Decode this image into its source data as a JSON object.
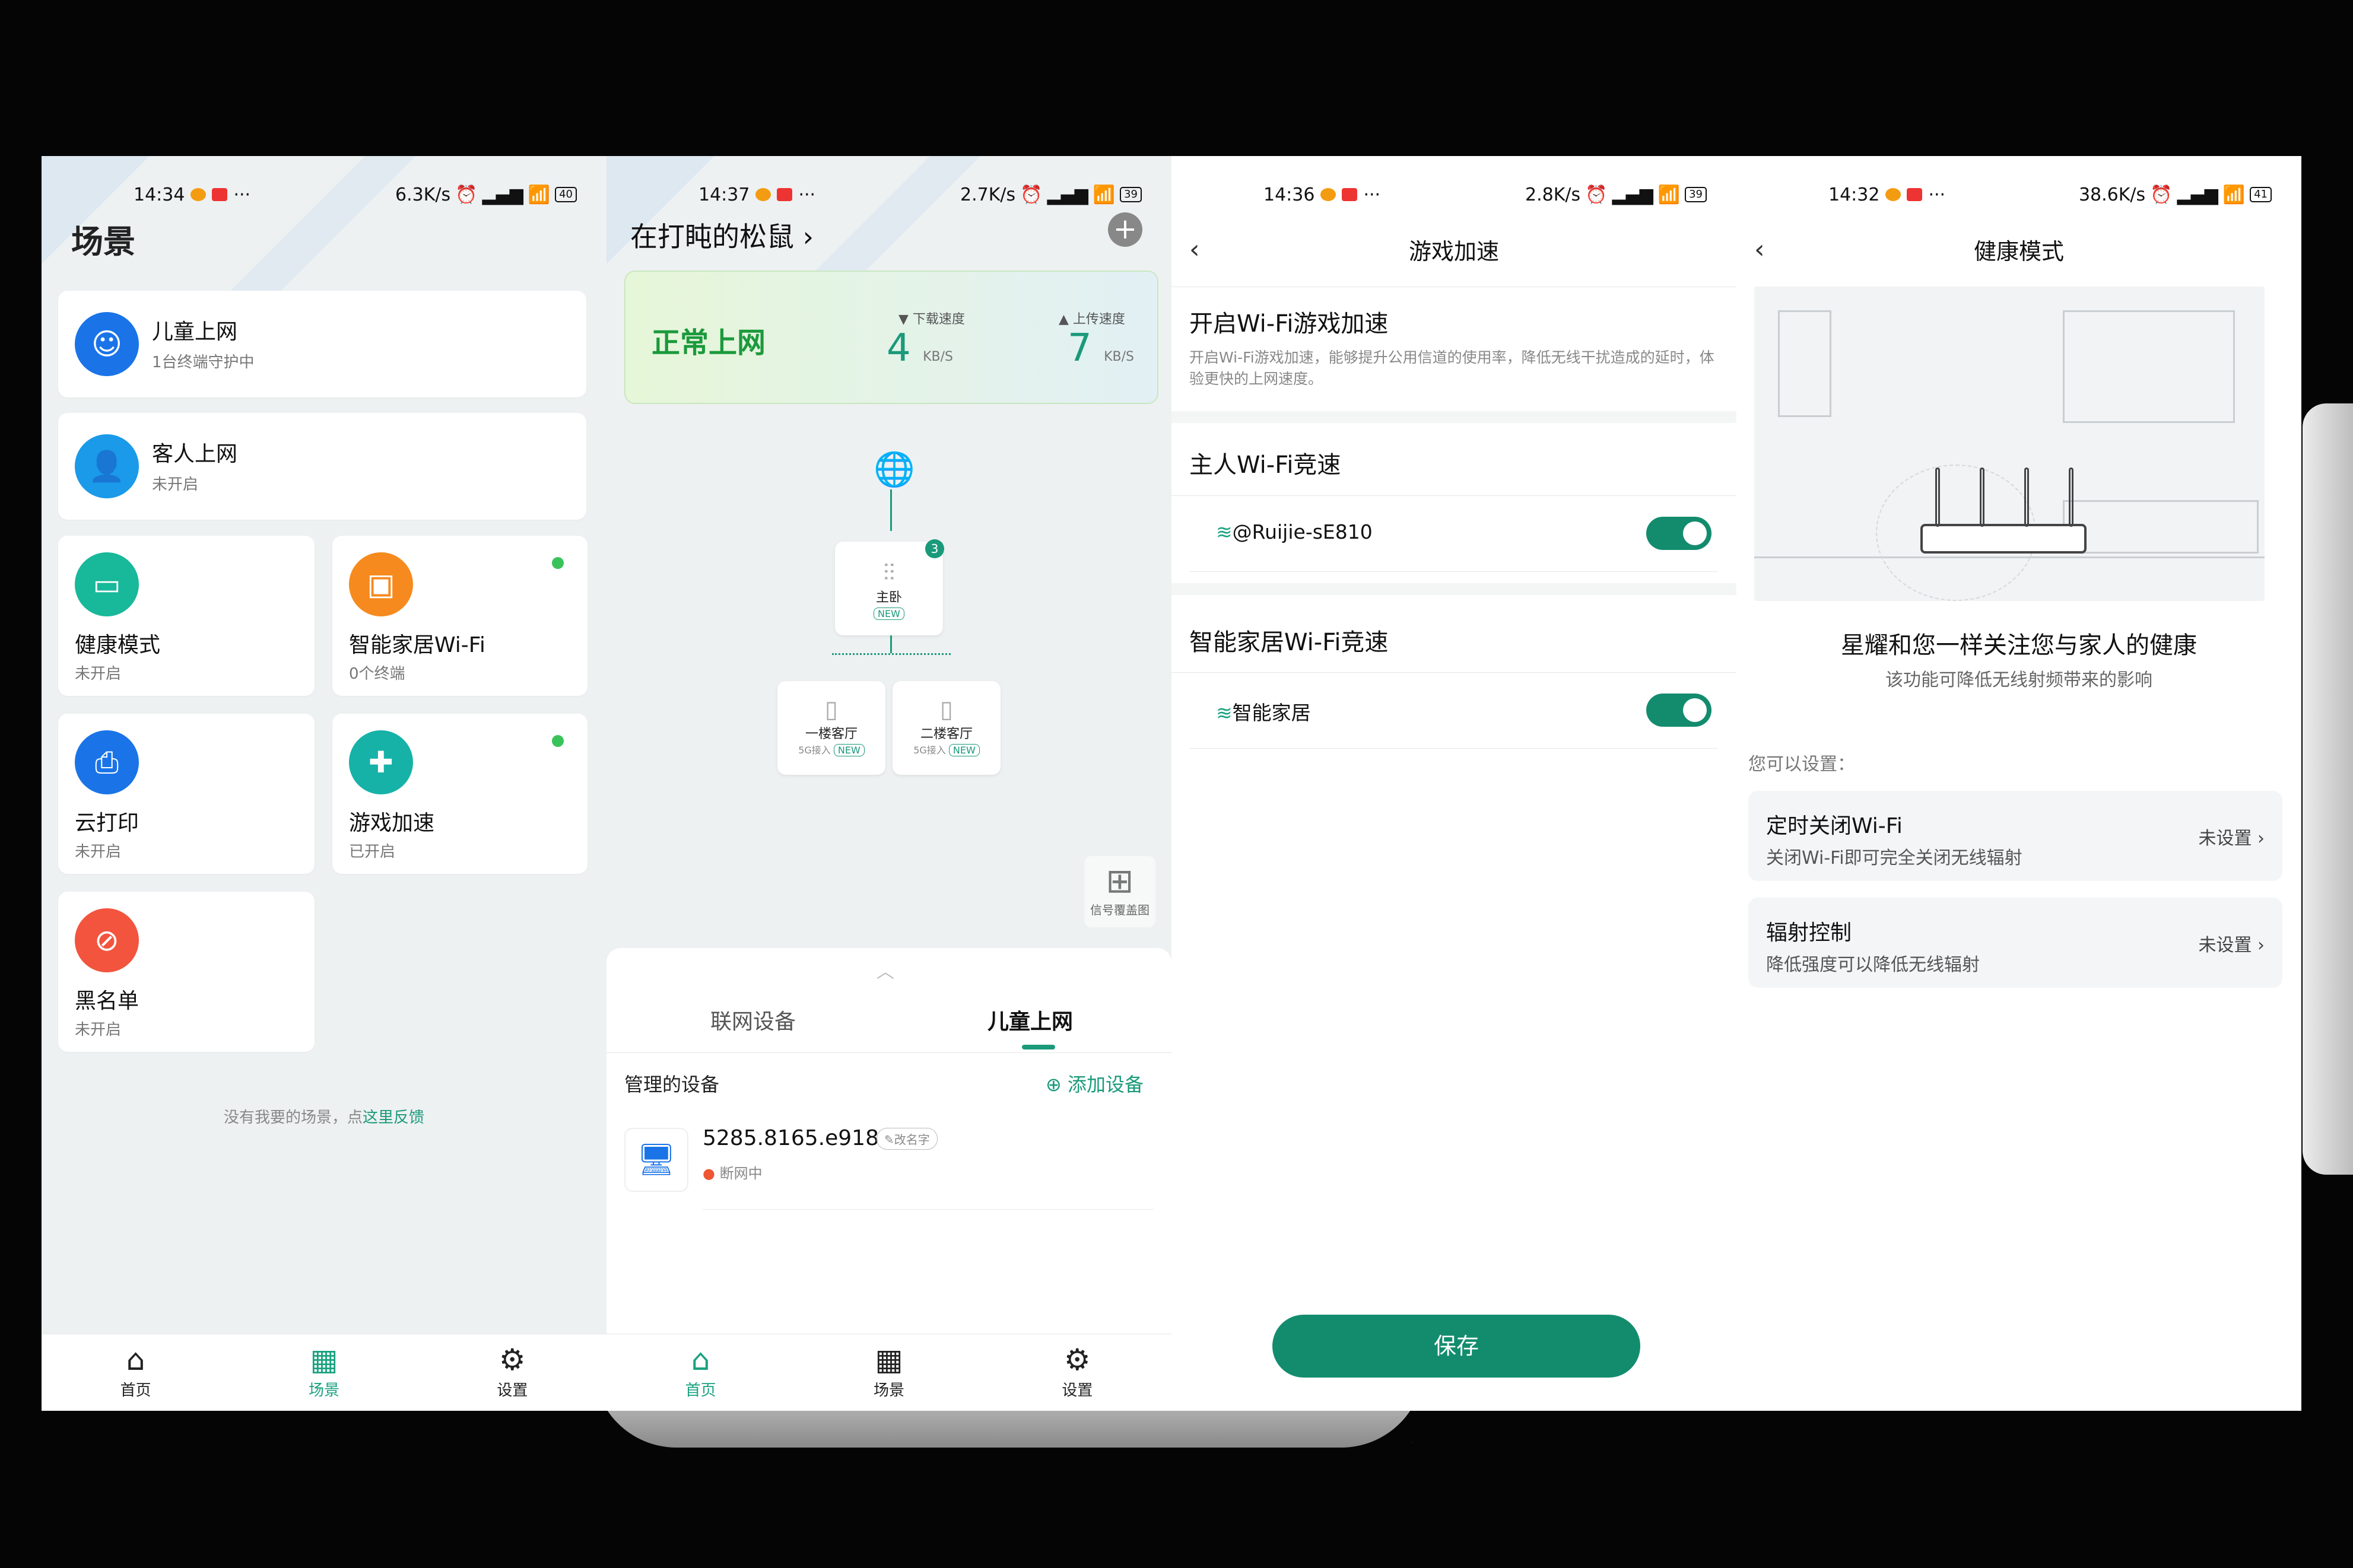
{
  "panels": {
    "scenes": {
      "status": {
        "time": "14:34",
        "speed": "6.3K/s",
        "battery": "40"
      },
      "title": "场景",
      "cards": [
        {
          "title": "儿童上网",
          "sub": "1台终端守护中",
          "icon": "child-face-icon"
        },
        {
          "title": "客人上网",
          "sub": "未开启",
          "icon": "guest-user-icon"
        },
        {
          "title": "健康模式",
          "sub": "未开启",
          "icon": "monitor-heart-icon"
        },
        {
          "title": "智能家居Wi-Fi",
          "sub": "0个终端",
          "icon": "smart-home-icon"
        },
        {
          "title": "云打印",
          "sub": "未开启",
          "icon": "printer-icon"
        },
        {
          "title": "游戏加速",
          "sub": "已开启",
          "icon": "gamepad-icon"
        },
        {
          "title": "黑名单",
          "sub": "未开启",
          "icon": "block-user-icon"
        }
      ],
      "feedback_text": "没有我要的场景，点",
      "feedback_link": "这里反馈",
      "tabs": [
        "首页",
        "场景",
        "设置"
      ]
    },
    "home": {
      "status": {
        "time": "14:37",
        "speed": "2.7K/s",
        "battery": "39"
      },
      "title": "在打盹的松鼠 ›",
      "net_status": "正常上网",
      "download_label": "下载速度",
      "download_value": "4",
      "upload_label": "上传速度",
      "upload_value": "7",
      "speed_unit": "KB/S",
      "nodes": {
        "main": {
          "name": "主卧",
          "badge": "3",
          "tag": "NEW"
        },
        "sub1": {
          "name": "一楼客厅",
          "link": "5G接入",
          "tag": "NEW"
        },
        "sub2": {
          "name": "二楼客厅",
          "link": "5G接入",
          "tag": "NEW"
        }
      },
      "coverage_label": "信号覆盖图",
      "sheet_tabs": [
        "联网设备",
        "儿童上网"
      ],
      "managed_label": "管理的设备",
      "add_device": "添加设备",
      "device": {
        "name": "5285.8165.e918",
        "rename": "改名字",
        "status": "断网中"
      },
      "tabs": [
        "首页",
        "场景",
        "设置"
      ]
    },
    "game": {
      "status": {
        "time": "14:36",
        "speed": "2.8K/s",
        "battery": "39"
      },
      "nav_title": "游戏加速",
      "section_title": "开启Wi-Fi游戏加速",
      "section_desc": "开启Wi-Fi游戏加速，能够提升公用信道的使用率，降低无线干扰造成的延时，体验更快的上网速度。",
      "host_title": "主人Wi-Fi竞速",
      "host_ssid": "@Ruijie-sE810",
      "smart_title": "智能家居Wi-Fi竞速",
      "smart_ssid": "智能家居",
      "save_label": "保存"
    },
    "health": {
      "status": {
        "time": "14:32",
        "speed": "38.6K/s",
        "battery": "41"
      },
      "nav_title": "健康模式",
      "headline": "星耀和您一样关注您与家人的健康",
      "subline": "该功能可降低无线射频带来的影响",
      "can_set": "您可以设置：",
      "settings": [
        {
          "title": "定时关闭Wi-Fi",
          "sub": "关闭Wi-Fi即可完全关闭无线辐射",
          "value": "未设置 ›"
        },
        {
          "title": "辐射控制",
          "sub": "降低强度可以降低无线辐射",
          "value": "未设置 ›"
        }
      ]
    }
  },
  "colors": {
    "accent": "#138c6e",
    "ok_green": "#1b9a3c"
  }
}
